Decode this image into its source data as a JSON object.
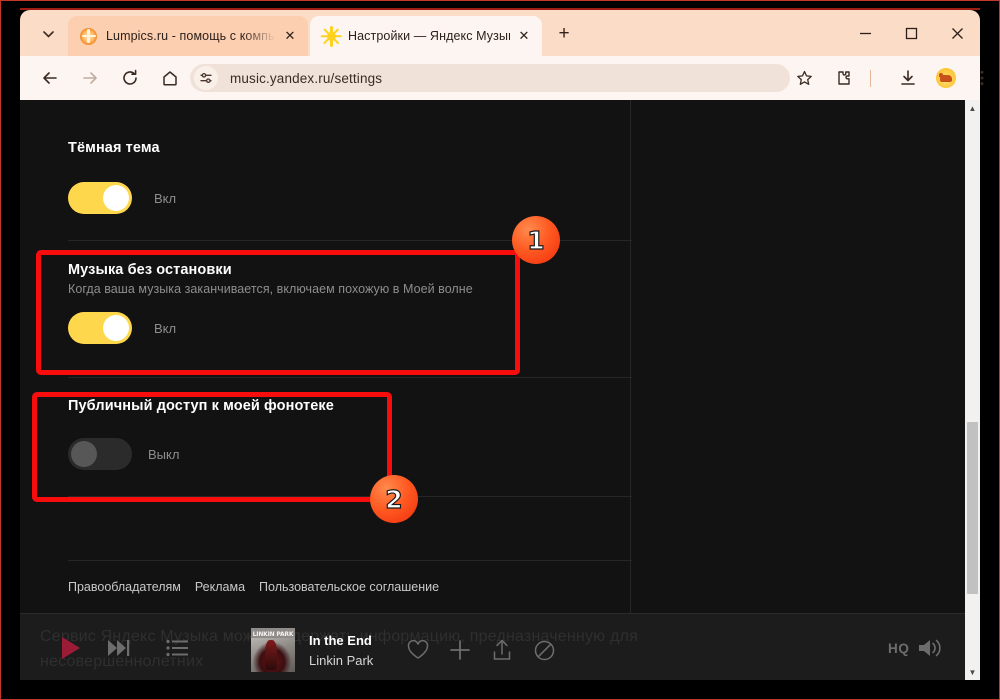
{
  "browser": {
    "tabs": [
      {
        "title": "Lumpics.ru - помощь с компью",
        "favicon": "orange-slice-icon",
        "active": false,
        "close_label": "✕"
      },
      {
        "title": "Настройки — Яндекс Музыка",
        "favicon": "yandex-music-icon",
        "active": true,
        "close_label": "✕"
      }
    ],
    "tab_list_chevron": "⌄",
    "new_tab_label": "+",
    "window_controls": {
      "minimize": "minimize-icon",
      "maximize": "maximize-icon",
      "close": "close-icon"
    },
    "toolbar": {
      "back": "back-arrow-icon",
      "forward": "forward-arrow-icon",
      "reload": "reload-icon",
      "home": "home-icon",
      "site_settings": "site-settings-icon",
      "url": "music.yandex.ru/settings",
      "bookmark": "star-icon",
      "extensions": "puzzle-icon",
      "downloads": "download-icon",
      "profile": "dog-avatar-icon",
      "menu": "three-dot-menu-icon"
    }
  },
  "page": {
    "sections": [
      {
        "title": "Тёмная тема",
        "subtitle": "",
        "toggle_state": "on",
        "toggle_label": "Вкл"
      },
      {
        "title": "Музыка без остановки",
        "subtitle": "Когда ваша музыка заканчивается, включаем похожую в Моей волне",
        "toggle_state": "on",
        "toggle_label": "Вкл"
      },
      {
        "title": "Публичный доступ к моей фонотеке",
        "subtitle": "",
        "toggle_state": "off",
        "toggle_label": "Выкл"
      }
    ],
    "footer_links": [
      "Правообладателям",
      "Реклама",
      "Пользовательское соглашение"
    ]
  },
  "annotations": [
    {
      "badge": "1",
      "target": "Музыка без остановки"
    },
    {
      "badge": "2",
      "target": "Публичный доступ к моей фонотеке"
    }
  ],
  "player": {
    "disclaimer": "Сервис Яндекс Музыка может содержать информацию, предназначенную для несовершеннолетних",
    "play_icon": "play-icon",
    "next_icon": "next-track-icon",
    "queue_icon": "queue-list-icon",
    "cover_band": "LINKIN PARK",
    "track_title": "In the End",
    "track_artist": "Linkin Park",
    "like_icon": "heart-icon",
    "add_icon": "plus-icon",
    "share_icon": "share-icon",
    "block_icon": "ban-icon",
    "quality_label": "HQ",
    "volume_icon": "volume-icon"
  },
  "scrollbar": {
    "up": "▲",
    "down": "▼"
  },
  "colors": {
    "accent_yellow": "#ffd74d",
    "highlight_red": "#f90c0c",
    "badge_orange": "#ff5a22",
    "chrome_tab_bg": "#fbdcc6",
    "page_bg": "#121212"
  }
}
